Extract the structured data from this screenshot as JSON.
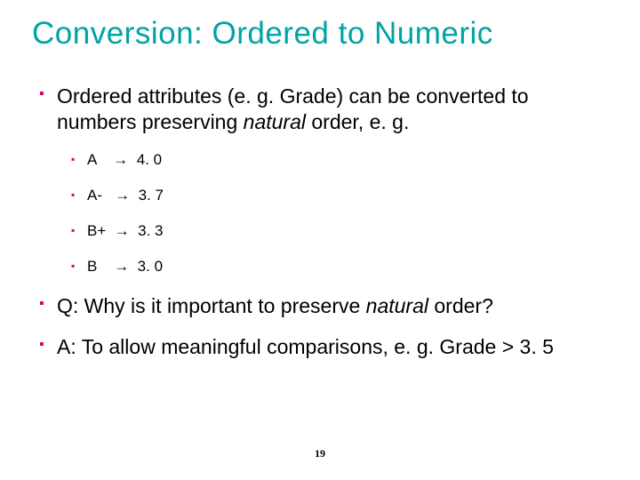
{
  "title": "Conversion: Ordered to Numeric",
  "p1_a": "Ordered attributes (e. g. Grade) can be converted to numbers preserving ",
  "p1_i": "natural",
  "p1_b": " order, e. g.",
  "items": {
    "a": "A    →  4. 0",
    "am": "A-   →  3. 7",
    "bp": "B+  →  3. 3",
    "b": "B    →  3. 0"
  },
  "q_a": "Q: Why is it important to preserve ",
  "q_i": "natural",
  "q_b": " order?",
  "ans": "A: To allow meaningful comparisons, e. g. Grade > 3. 5",
  "page": "19"
}
